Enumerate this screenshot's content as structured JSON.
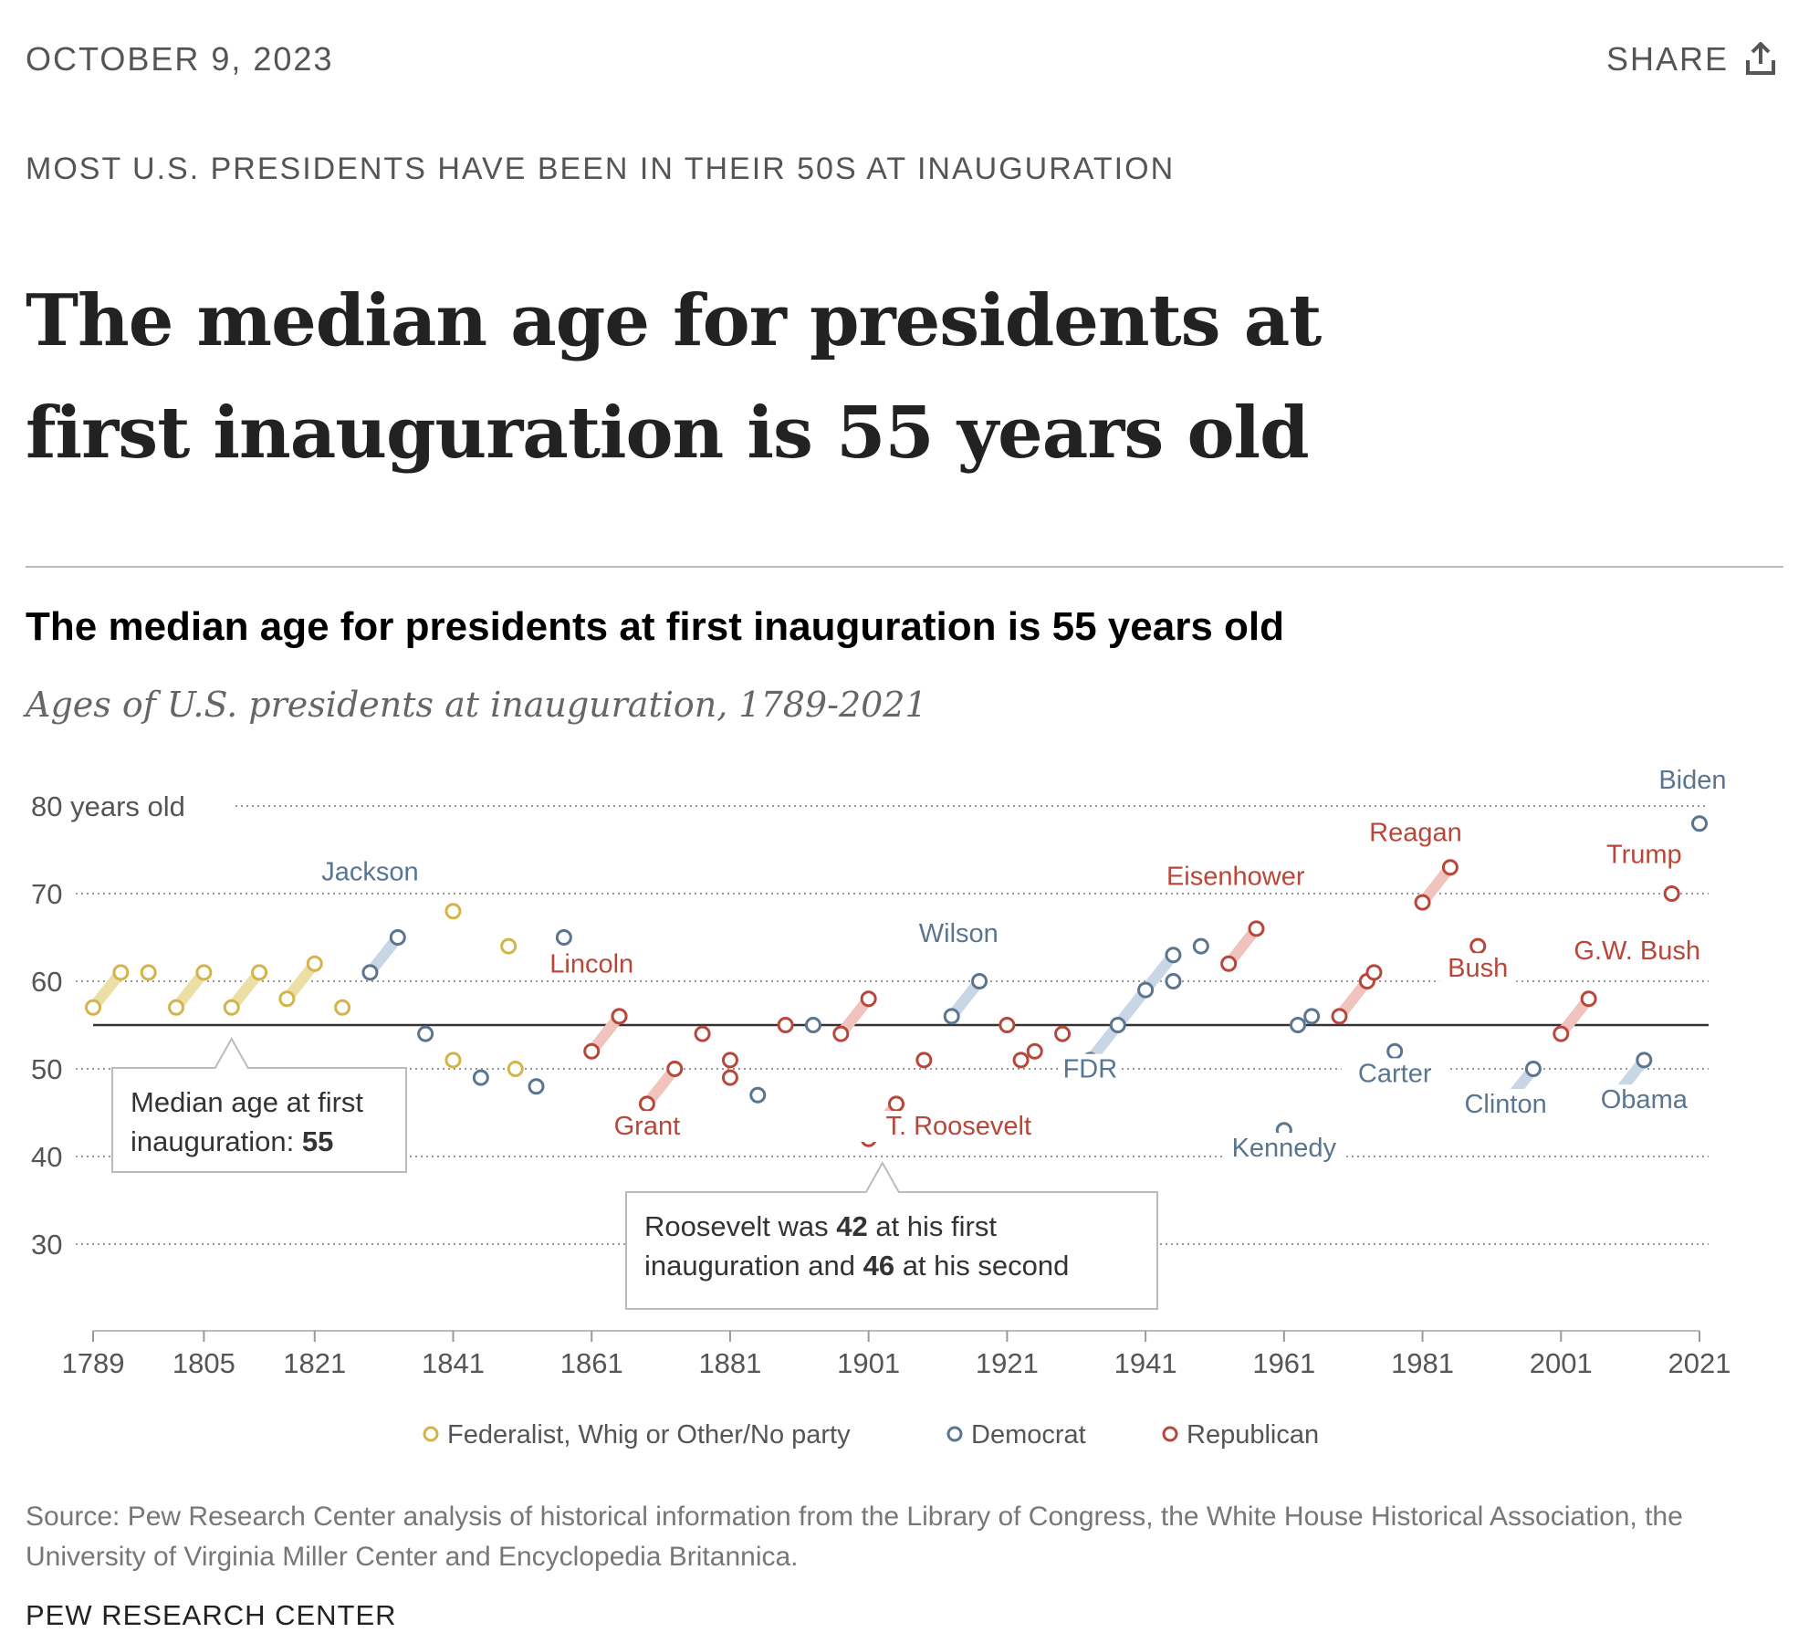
{
  "page": {
    "date": "OCTOBER 9, 2023",
    "share_label": "SHARE",
    "share_icon": "share-upload-icon",
    "kicker": "MOST U.S. PRESIDENTS HAVE BEEN IN THEIR 50S AT INAUGURATION",
    "headline": "The median age for presidents at first inauguration is 55 years old",
    "source": "Source: Pew Research Center analysis of historical information from the Library of Congress, the White House Historical Association, the University of Virginia Miller Center and Encyclopedia Britannica.",
    "brand": "PEW RESEARCH CENTER"
  },
  "chart_data": {
    "type": "scatter",
    "title": "The median age for presidents at first inauguration is 55 years old",
    "subtitle": "Ages of U.S. presidents at inauguration, 1789-2021",
    "xlabel": "",
    "ylabel": "",
    "xlim": [
      1789,
      2021
    ],
    "ylim": [
      20,
      82
    ],
    "x_ticks": [
      1789,
      1805,
      1821,
      1841,
      1861,
      1881,
      1901,
      1921,
      1941,
      1961,
      1981,
      2001,
      2021
    ],
    "y_ticks": [
      {
        "value": 30,
        "label": "30"
      },
      {
        "value": 40,
        "label": "40"
      },
      {
        "value": 50,
        "label": "50"
      },
      {
        "value": 60,
        "label": "60"
      },
      {
        "value": 70,
        "label": "70"
      },
      {
        "value": 80,
        "label": "80 years old"
      }
    ],
    "grid": true,
    "median": 55,
    "legend_position": "bottom",
    "colors": {
      "other": "#d4b44a",
      "democrat": "#5a7590",
      "republican": "#b8473a",
      "other_link": "#ecdfa6",
      "democrat_link": "#c8d6e5",
      "republican_link": "#f0c3bc",
      "median_line": "#333333",
      "grid": "#999999",
      "axis_text": "#555555"
    },
    "series": [
      {
        "name": "Federalist, Whig or Other/No party",
        "key": "other",
        "points": [
          {
            "x": 1789,
            "y": 57
          },
          {
            "x": 1793,
            "y": 61
          },
          {
            "x": 1797,
            "y": 61
          },
          {
            "x": 1801,
            "y": 57
          },
          {
            "x": 1805,
            "y": 61
          },
          {
            "x": 1809,
            "y": 57
          },
          {
            "x": 1813,
            "y": 61
          },
          {
            "x": 1817,
            "y": 58
          },
          {
            "x": 1821,
            "y": 62
          },
          {
            "x": 1825,
            "y": 57
          },
          {
            "x": 1841,
            "y": 68
          },
          {
            "x": 1841,
            "y": 51
          },
          {
            "x": 1849,
            "y": 64
          },
          {
            "x": 1850,
            "y": 50
          }
        ],
        "links": [
          [
            0,
            1
          ],
          [
            3,
            4
          ],
          [
            5,
            6
          ],
          [
            7,
            8
          ]
        ]
      },
      {
        "name": "Democrat",
        "key": "democrat",
        "points": [
          {
            "x": 1829,
            "y": 61
          },
          {
            "x": 1833,
            "y": 65
          },
          {
            "x": 1837,
            "y": 54
          },
          {
            "x": 1845,
            "y": 49
          },
          {
            "x": 1853,
            "y": 48
          },
          {
            "x": 1857,
            "y": 65
          },
          {
            "x": 1865,
            "y": 56
          },
          {
            "x": 1885,
            "y": 47
          },
          {
            "x": 1893,
            "y": 55
          },
          {
            "x": 1913,
            "y": 56
          },
          {
            "x": 1917,
            "y": 60
          },
          {
            "x": 1933,
            "y": 51
          },
          {
            "x": 1937,
            "y": 55
          },
          {
            "x": 1941,
            "y": 59
          },
          {
            "x": 1945,
            "y": 63
          },
          {
            "x": 1945,
            "y": 60
          },
          {
            "x": 1949,
            "y": 64
          },
          {
            "x": 1961,
            "y": 43
          },
          {
            "x": 1963,
            "y": 55
          },
          {
            "x": 1965,
            "y": 56
          },
          {
            "x": 1977,
            "y": 52
          },
          {
            "x": 1993,
            "y": 46
          },
          {
            "x": 1997,
            "y": 50
          },
          {
            "x": 2009,
            "y": 47
          },
          {
            "x": 2013,
            "y": 51
          },
          {
            "x": 2021,
            "y": 78
          }
        ],
        "links": [
          [
            0,
            1
          ],
          [
            9,
            10
          ],
          [
            11,
            12
          ],
          [
            12,
            13
          ],
          [
            13,
            14
          ],
          [
            21,
            22
          ],
          [
            23,
            24
          ]
        ]
      },
      {
        "name": "Republican",
        "key": "republican",
        "points": [
          {
            "x": 1861,
            "y": 52
          },
          {
            "x": 1865,
            "y": 56
          },
          {
            "x": 1869,
            "y": 46
          },
          {
            "x": 1873,
            "y": 50
          },
          {
            "x": 1877,
            "y": 54
          },
          {
            "x": 1881,
            "y": 49
          },
          {
            "x": 1881,
            "y": 51
          },
          {
            "x": 1889,
            "y": 55
          },
          {
            "x": 1897,
            "y": 54
          },
          {
            "x": 1901,
            "y": 58
          },
          {
            "x": 1901,
            "y": 42
          },
          {
            "x": 1905,
            "y": 46
          },
          {
            "x": 1909,
            "y": 51
          },
          {
            "x": 1921,
            "y": 55
          },
          {
            "x": 1923,
            "y": 51
          },
          {
            "x": 1925,
            "y": 52
          },
          {
            "x": 1929,
            "y": 54
          },
          {
            "x": 1953,
            "y": 62
          },
          {
            "x": 1957,
            "y": 66
          },
          {
            "x": 1969,
            "y": 56
          },
          {
            "x": 1973,
            "y": 60
          },
          {
            "x": 1974,
            "y": 61
          },
          {
            "x": 1981,
            "y": 69
          },
          {
            "x": 1985,
            "y": 73
          },
          {
            "x": 1989,
            "y": 64
          },
          {
            "x": 2001,
            "y": 54
          },
          {
            "x": 2005,
            "y": 58
          },
          {
            "x": 2017,
            "y": 70
          }
        ],
        "links": [
          [
            0,
            1
          ],
          [
            2,
            3
          ],
          [
            8,
            9
          ],
          [
            10,
            11
          ],
          [
            17,
            18
          ],
          [
            19,
            20
          ],
          [
            22,
            23
          ],
          [
            25,
            26
          ]
        ]
      }
    ],
    "labels": [
      {
        "text": "Jackson",
        "series": "democrat",
        "x": 1829,
        "y": 71.5
      },
      {
        "text": "Lincoln",
        "series": "republican",
        "x": 1861,
        "y": 61
      },
      {
        "text": "Grant",
        "series": "republican",
        "x": 1869,
        "y": 42.5
      },
      {
        "text": "Wilson",
        "series": "democrat",
        "x": 1914,
        "y": 64.5
      },
      {
        "text": "T. Roosevelt",
        "series": "republican",
        "x": 1914,
        "y": 42.5
      },
      {
        "text": "FDR",
        "series": "democrat",
        "x": 1933,
        "y": 49
      },
      {
        "text": "Eisenhower",
        "series": "republican",
        "x": 1954,
        "y": 71
      },
      {
        "text": "Kennedy",
        "series": "democrat",
        "x": 1961,
        "y": 40
      },
      {
        "text": "Reagan",
        "series": "republican",
        "x": 1980,
        "y": 76
      },
      {
        "text": "Carter",
        "series": "democrat",
        "x": 1977,
        "y": 48.5
      },
      {
        "text": "Bush",
        "series": "republican",
        "x": 1989,
        "y": 60.5
      },
      {
        "text": "Clinton",
        "series": "democrat",
        "x": 1993,
        "y": 45
      },
      {
        "text": "Trump",
        "series": "republican",
        "x": 2013,
        "y": 73.5
      },
      {
        "text": "G.W. Bush",
        "series": "republican",
        "x": 2012,
        "y": 62.5
      },
      {
        "text": "Biden",
        "series": "democrat",
        "x": 2020,
        "y": 82
      },
      {
        "text": "Obama",
        "series": "democrat",
        "x": 2013,
        "y": 45.5
      }
    ],
    "callouts": [
      {
        "line1": "Median age at first",
        "line2_prefix": "inauguration: ",
        "line2_bold": "55",
        "line2_suffix": ""
      },
      {
        "line1_prefix": "Roosevelt was ",
        "line1_bold": "42",
        "line1_suffix": " at his first",
        "line2_prefix": "inauguration and ",
        "line2_bold": "46",
        "line2_suffix": " at his second"
      }
    ]
  }
}
